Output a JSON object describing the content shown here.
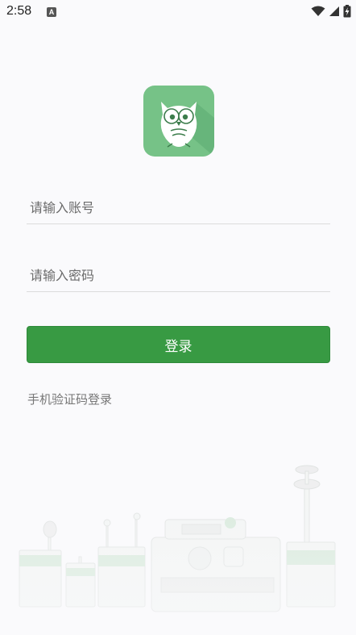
{
  "status_bar": {
    "time": "2:58",
    "notification_badge": "A"
  },
  "login": {
    "account_placeholder": "请输入账号",
    "password_placeholder": "请输入密码",
    "login_label": "登录",
    "sms_login_label": "手机验证码登录"
  },
  "colors": {
    "primary": "#389a43",
    "logo_bg": "#76c287",
    "background": "#fafafc"
  },
  "icons": {
    "logo": "owl-logo-icon",
    "wifi": "wifi-icon",
    "signal": "signal-icon",
    "battery": "battery-charging-icon"
  }
}
